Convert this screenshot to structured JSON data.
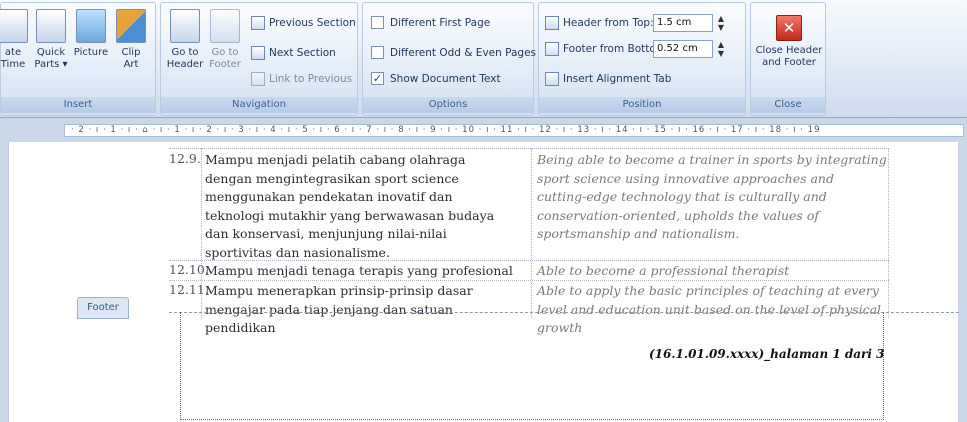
{
  "ribbon": {
    "insert": {
      "label": "Insert",
      "date_time": "ate\nTime",
      "quick_parts": "Quick\nParts ▾",
      "picture": "Picture",
      "clip_art": "Clip\nArt"
    },
    "navigation": {
      "label": "Navigation",
      "goto_header": "Go to\nHeader",
      "goto_footer": "Go to\nFooter",
      "previous_section": "Previous Section",
      "next_section": "Next Section",
      "link_to_previous": "Link to Previous"
    },
    "options": {
      "label": "Options",
      "different_first_page": "Different First Page",
      "different_odd_even": "Different Odd & Even Pages",
      "show_document_text": "Show Document Text",
      "show_document_text_checked": "✓"
    },
    "position": {
      "label": "Position",
      "header_from_top_label": "Header from Top:",
      "header_from_top_value": "1.5 cm",
      "footer_from_bottom_label": "Footer from Bottom:",
      "footer_from_bottom_value": "0.52 cm",
      "insert_alignment_tab": "Insert Alignment Tab"
    },
    "close": {
      "label": "Close",
      "close_header_footer": "Close Header\nand Footer"
    }
  },
  "ruler": {
    "text": "· 2 · ı · 1 · ı · ⌂ · ı · 1 · ı · 2 · ı · 3 · ı · 4 · ı · 5 · ı · 6 · ı · 7 · ı · 8 · ı · 9 · ı · 10 · ı · 11 · ı · 12 · ı · 13 · ı · 14 · ı · 15 · ı · 16 · ı · 17 · ı · 18 · ı · 19"
  },
  "table": {
    "rows": [
      {
        "no": "12.9.",
        "id": "Mampu menjadi pelatih cabang olahraga dengan mengintegrasikan sport science menggunakan pendekatan inovatif dan teknologi mutakhir yang berwawasan budaya dan konservasi, menjunjung nilai-nilai sportivitas dan nasionalisme.",
        "en": "Being able to become a trainer in sports by integrating sport science using innovative approaches and cutting-edge technology that is culturally and conservation-oriented, upholds the values of sportsmanship and nationalism."
      },
      {
        "no": "12.10.",
        "id": "Mampu menjadi tenaga terapis yang profesional",
        "en": "Able to become a professional therapist"
      },
      {
        "no": "12.11.",
        "id": "Mampu menerapkan prinsip-prinsip dasar mengajar pada tiap jenjang dan satuan pendidikan",
        "en": "Able to apply the basic principles of teaching at every level and education unit based on the level of physical growth"
      }
    ]
  },
  "footer": {
    "tab_label": "Footer",
    "text": "(16.1.01.09.xxxx)_halaman 1 dari 3"
  }
}
